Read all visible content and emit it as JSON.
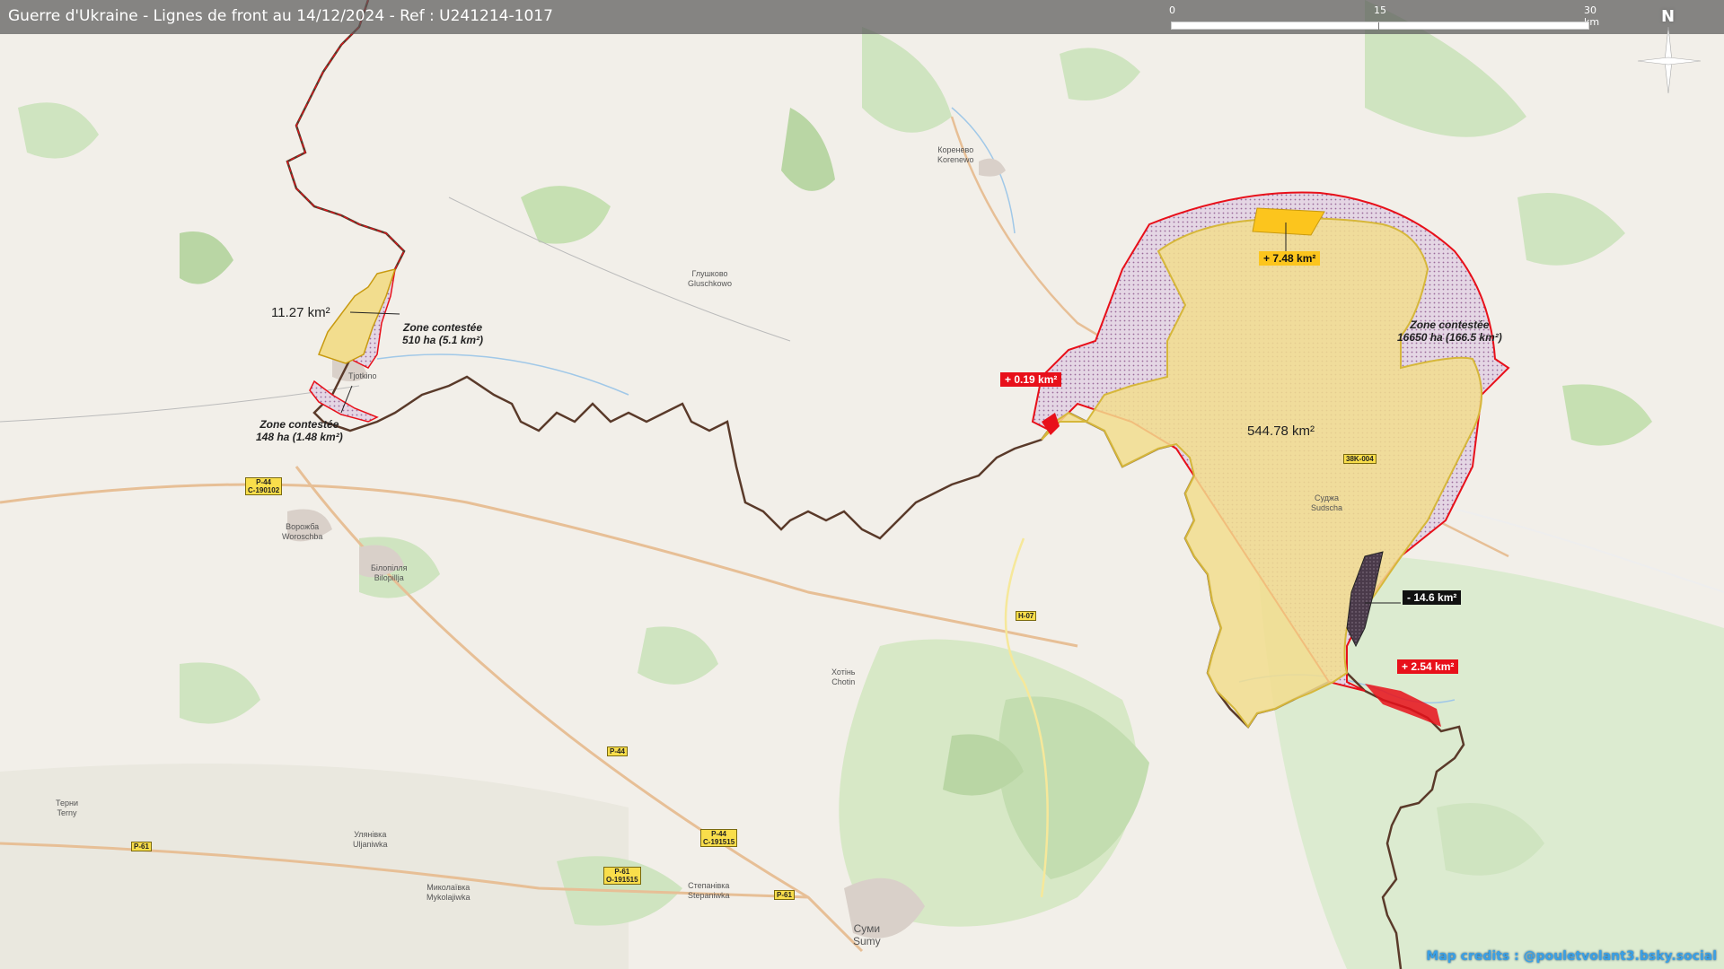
{
  "header": {
    "title": "Guerre d'Ukraine - Lignes de front au 14/12/2024 - Ref : U241214-1017",
    "scale": {
      "t0": "0",
      "t15": "15",
      "t30": "30 km"
    },
    "north": "N"
  },
  "areas": {
    "main": "544.78 km²",
    "west": "11.27 km²"
  },
  "zones": {
    "north_name": "Zone contestée",
    "north_size": "510 ha (5.1 km²)",
    "south_name": "Zone contestée",
    "south_size": "148 ha (1.48 km²)",
    "east_name": "Zone contestée",
    "east_size": "16650 ha (166.5 km²)"
  },
  "changes": {
    "yellow_gain": "+ 7.48 km²",
    "west_gain": "+ 0.19 km²",
    "loss": "- 14.6 km²",
    "south_gain": "+ 2.54 km²"
  },
  "towns": {
    "korenevo_ua": "Коренево",
    "korenevo": "Korenewo",
    "glushkovo_ua": "Глушково",
    "glushkovo": "Gluschkowo",
    "tyotkino": "Tjotkino",
    "vorozhba_ua": "Ворожба",
    "vorozhba": "Woroschba",
    "bilopillia_ua": "Білопілля",
    "bilopillia": "Bilopillja",
    "sudzha_ua": "Суджа",
    "sudzha": "Sudscha",
    "khotin_ua": "Хотінь",
    "khotin": "Chotin",
    "terny_ua": "Терни",
    "terny": "Terny",
    "ulianivka_ua": "Улянівка",
    "ulianivka": "Uljaniwka",
    "mykolaivka_ua": "Миколаївка",
    "mykolaivka": "Mykolajiwka",
    "stepanivka_ua": "Степанівка",
    "stepanivka": "Stepaniwka",
    "sumy_ua": "Суми",
    "sumy": "Sumy"
  },
  "roads": {
    "p44a": "P-44",
    "c190102": "C-190102",
    "p44b": "P-44",
    "p44c": "P-44",
    "c191515": "C-191515",
    "p61a": "P-61",
    "p61b": "P-61",
    "o191515": "O-191515",
    "p61c": "P-61",
    "h07": "H-07",
    "r38k004": "38K-004"
  },
  "credits": "Map credits : @pouletvolant3.bsky.social",
  "colors": {
    "controlled_fill": "#f2dd8e",
    "controlled_stroke": "#d6b73a",
    "contested_fill": "#dcc8dc",
    "front_line": "#e8101a",
    "border": "#5a3a2a",
    "gain_yellow": "#fcc51d",
    "loss": "#4a3a4a",
    "forest": "#add19e",
    "meadow": "#cdebb0"
  }
}
